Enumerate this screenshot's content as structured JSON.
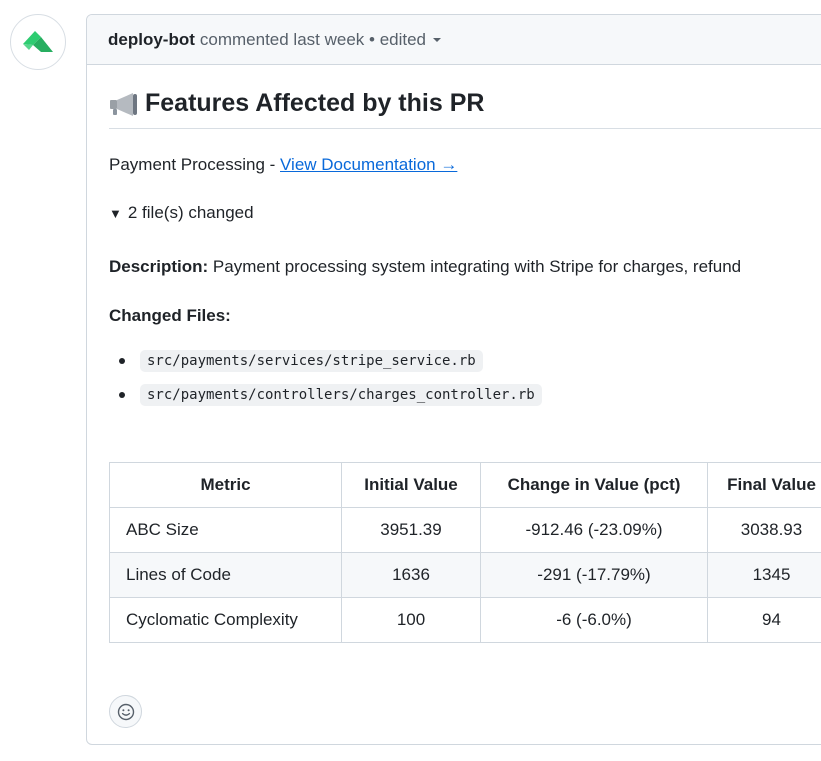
{
  "comment": {
    "author": "deploy-bot",
    "meta": "commented last week • edited"
  },
  "content": {
    "heading": "Features Affected by this PR",
    "feature_name": "Payment Processing - ",
    "doc_link": "View Documentation →",
    "details_summary": "2 file(s) changed",
    "description_label": "Description:",
    "description_text": " Payment processing system integrating with Stripe for charges, refund",
    "changed_files_label": "Changed Files:",
    "files": [
      "src/payments/services/stripe_service.rb",
      "src/payments/controllers/charges_controller.rb"
    ]
  },
  "table": {
    "headers": [
      "Metric",
      "Initial Value",
      "Change in Value (pct)",
      "Final Value"
    ],
    "rows": [
      [
        "ABC Size",
        "3951.39",
        "-912.46 (-23.09%)",
        "3038.93"
      ],
      [
        "Lines of Code",
        "1636",
        "-291 (-17.79%)",
        "1345"
      ],
      [
        "Cyclomatic Complexity",
        "100",
        "-6 (-6.0%)",
        "94"
      ]
    ]
  },
  "colors": {
    "link": "#0969da",
    "avatar_green": "#2ecc71",
    "border": "#d0d7de",
    "header_bg": "#f6f8fa"
  },
  "icons": {
    "avatar": "deploy-bot-avatar-icon",
    "megaphone": "megaphone-icon",
    "caret": "caret-down-icon",
    "reaction": "smiley-icon"
  }
}
